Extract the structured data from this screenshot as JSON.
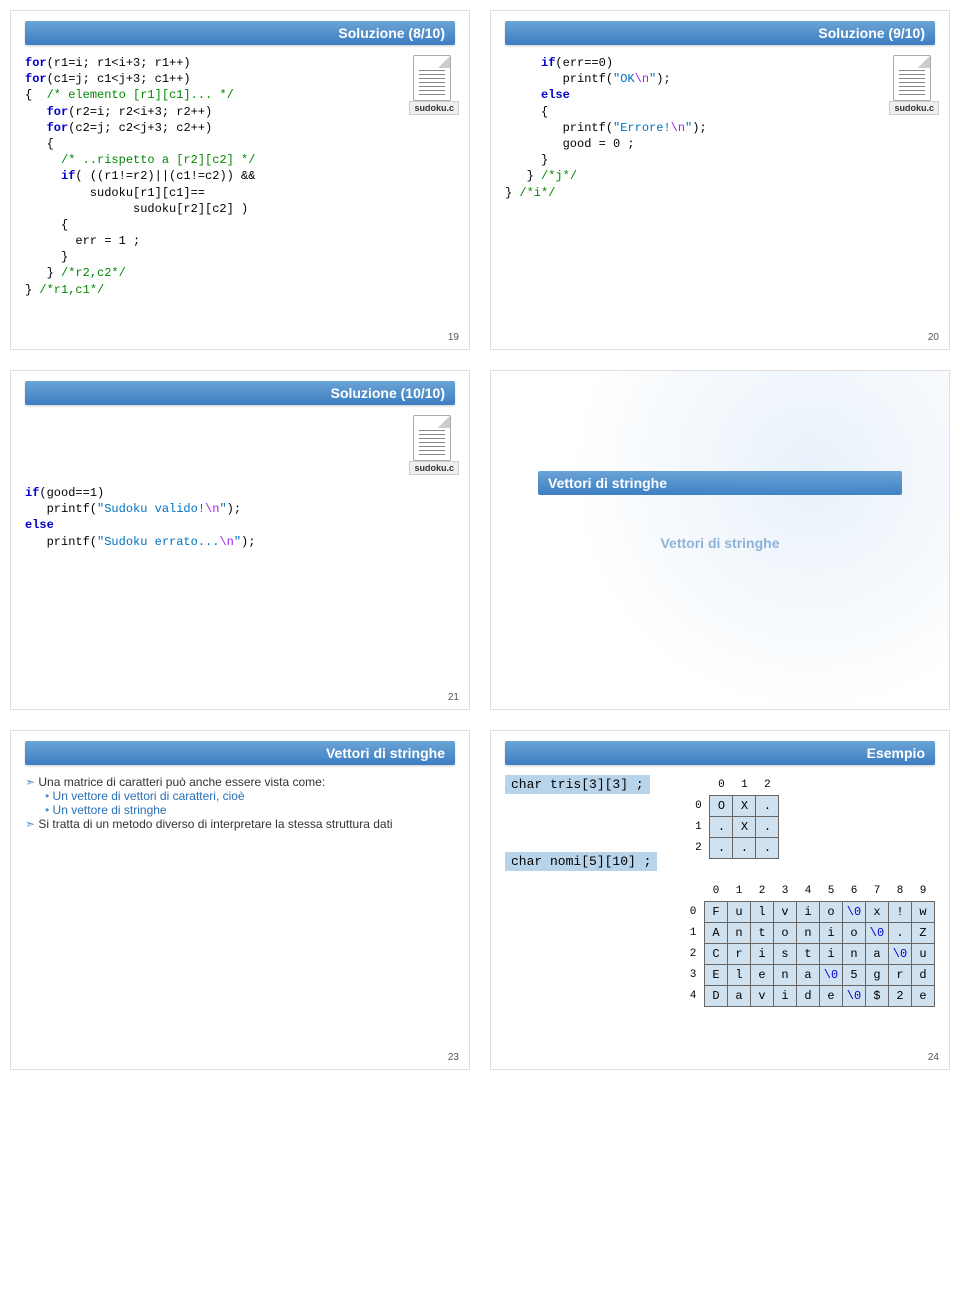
{
  "slides": {
    "s8": {
      "title": "Soluzione (8/10)",
      "file": "sudoku.c",
      "page": "19",
      "code_lines": [
        {
          "segs": [
            [
              "kw",
              "for"
            ],
            [
              "txt",
              "(r1=i; r1<i+3; r1++)"
            ]
          ]
        },
        {
          "segs": [
            [
              "kw",
              "for"
            ],
            [
              "txt",
              "(c1=j; c1<j+3; c1++)"
            ]
          ]
        },
        {
          "segs": [
            [
              "txt",
              "{  "
            ],
            [
              "cm",
              "/* elemento [r1][c1]... */"
            ]
          ]
        },
        {
          "segs": [
            [
              "txt",
              "   "
            ],
            [
              "kw",
              "for"
            ],
            [
              "txt",
              "(r2=i; r2<i+3; r2++)"
            ]
          ]
        },
        {
          "segs": [
            [
              "txt",
              "   "
            ],
            [
              "kw",
              "for"
            ],
            [
              "txt",
              "(c2=j; c2<j+3; c2++)"
            ]
          ]
        },
        {
          "segs": [
            [
              "txt",
              "   {"
            ]
          ]
        },
        {
          "segs": [
            [
              "txt",
              "     "
            ],
            [
              "cm",
              "/* ..rispetto a [r2][c2] */"
            ]
          ]
        },
        {
          "segs": [
            [
              "txt",
              "     "
            ],
            [
              "kw",
              "if"
            ],
            [
              "txt",
              "( ((r1!=r2)||(c1!=c2)) &&"
            ]
          ]
        },
        {
          "segs": [
            [
              "txt",
              "         sudoku[r1][c1]=="
            ]
          ]
        },
        {
          "segs": [
            [
              "txt",
              "               sudoku[r2][c2] )"
            ]
          ]
        },
        {
          "segs": [
            [
              "txt",
              "     {"
            ]
          ]
        },
        {
          "segs": [
            [
              "txt",
              "       err = 1 ;"
            ]
          ]
        },
        {
          "segs": [
            [
              "txt",
              "     }"
            ]
          ]
        },
        {
          "segs": [
            [
              "txt",
              "   } "
            ],
            [
              "cm",
              "/*r2,c2*/"
            ]
          ]
        },
        {
          "segs": [
            [
              "txt",
              "} "
            ],
            [
              "cm",
              "/*r1,c1*/"
            ]
          ]
        }
      ]
    },
    "s9": {
      "title": "Soluzione (9/10)",
      "file": "sudoku.c",
      "page": "20",
      "code_lines": [
        {
          "segs": [
            [
              "txt",
              "     "
            ],
            [
              "kw",
              "if"
            ],
            [
              "txt",
              "(err==0)"
            ]
          ]
        },
        {
          "segs": [
            [
              "txt",
              "        printf("
            ],
            [
              "str",
              "\"OK"
            ],
            [
              "esc",
              "\\n"
            ],
            [
              "str",
              "\""
            ],
            [
              "txt",
              ");"
            ]
          ]
        },
        {
          "segs": [
            [
              "txt",
              "     "
            ],
            [
              "kw",
              "else"
            ]
          ]
        },
        {
          "segs": [
            [
              "txt",
              "     {"
            ]
          ]
        },
        {
          "segs": [
            [
              "txt",
              "        printf("
            ],
            [
              "str",
              "\"Errore!"
            ],
            [
              "esc",
              "\\n"
            ],
            [
              "str",
              "\""
            ],
            [
              "txt",
              ");"
            ]
          ]
        },
        {
          "segs": [
            [
              "txt",
              "        good = 0 ;"
            ]
          ]
        },
        {
          "segs": [
            [
              "txt",
              "     }"
            ]
          ]
        },
        {
          "segs": [
            [
              "txt",
              "   } "
            ],
            [
              "cm",
              "/*j*/"
            ]
          ]
        },
        {
          "segs": [
            [
              "txt",
              "} "
            ],
            [
              "cm",
              "/*i*/"
            ]
          ]
        }
      ]
    },
    "s10": {
      "title": "Soluzione (10/10)",
      "file": "sudoku.c",
      "page": "21",
      "code_lines": [
        {
          "segs": [
            [
              "kw",
              "if"
            ],
            [
              "txt",
              "(good==1)"
            ]
          ]
        },
        {
          "segs": [
            [
              "txt",
              "   printf("
            ],
            [
              "str",
              "\"Sudoku valido!"
            ],
            [
              "esc",
              "\\n"
            ],
            [
              "str",
              "\""
            ],
            [
              "txt",
              ");"
            ]
          ]
        },
        {
          "segs": [
            [
              "kw",
              "else"
            ]
          ]
        },
        {
          "segs": [
            [
              "txt",
              "   printf("
            ],
            [
              "str",
              "\"Sudoku errato..."
            ],
            [
              "esc",
              "\\n"
            ],
            [
              "str",
              "\""
            ],
            [
              "txt",
              ");"
            ]
          ]
        }
      ]
    },
    "sTitle": {
      "main": "Vettori di stringhe",
      "sub": "Vettori di stringhe"
    },
    "sVett": {
      "title": "Vettori di stringhe",
      "page": "23",
      "bullets": {
        "b1a": "Una matrice di caratteri può anche essere vista come:",
        "b2a": "Un vettore di vettori di caratteri, cioè",
        "b2b": "Un vettore di stringhe",
        "b1b": "Si tratta di un metodo diverso di interpretare la stessa struttura dati"
      }
    },
    "sEx": {
      "title": "Esempio",
      "page": "24",
      "decl1": "char tris[3][3] ;",
      "decl2": "char nomi[5][10] ;",
      "tris": {
        "cols": [
          "0",
          "1",
          "2"
        ],
        "rows": [
          "0",
          "1",
          "2"
        ],
        "data": [
          [
            "O",
            "X",
            "."
          ],
          [
            ".",
            "X",
            "."
          ],
          [
            ".",
            ".",
            "."
          ]
        ]
      },
      "nomi": {
        "cols": [
          "0",
          "1",
          "2",
          "3",
          "4",
          "5",
          "6",
          "7",
          "8",
          "9"
        ],
        "rows": [
          "0",
          "1",
          "2",
          "3",
          "4"
        ],
        "data": [
          [
            "F",
            "u",
            "l",
            "v",
            "i",
            "o",
            "\\0",
            "x",
            "!",
            "w"
          ],
          [
            "A",
            "n",
            "t",
            "o",
            "n",
            "i",
            "o",
            "\\0",
            ".",
            "Z"
          ],
          [
            "C",
            "r",
            "i",
            "s",
            "t",
            "i",
            "n",
            "a",
            "\\0",
            "u"
          ],
          [
            "E",
            "l",
            "e",
            "n",
            "a",
            "\\0",
            "5",
            "g",
            "r",
            "d"
          ],
          [
            "D",
            "a",
            "v",
            "i",
            "d",
            "e",
            "\\0",
            "$",
            "2",
            "e"
          ]
        ]
      }
    }
  }
}
